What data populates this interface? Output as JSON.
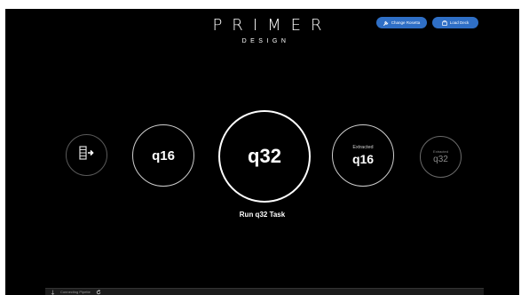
{
  "brand": {
    "title": "PRIMER",
    "subtitle": "DESIGN"
  },
  "toolbar": {
    "change_label": "Change Rosetta",
    "load_label": "Load Deck"
  },
  "carousel": {
    "prev_icon": "sidebar-arrow-icon",
    "items": [
      {
        "label": "q16"
      },
      {
        "label": "q32"
      },
      {
        "tag": "Extracted",
        "label": "q16"
      },
      {
        "tag": "Extracted",
        "label": "q32"
      }
    ]
  },
  "task": {
    "label": "Run q32 Task"
  },
  "status_bar": {
    "text": "Connecting Pipette"
  },
  "colors": {
    "background": "#000000",
    "accent": "#2f6fc6",
    "text": "#ffffff"
  }
}
